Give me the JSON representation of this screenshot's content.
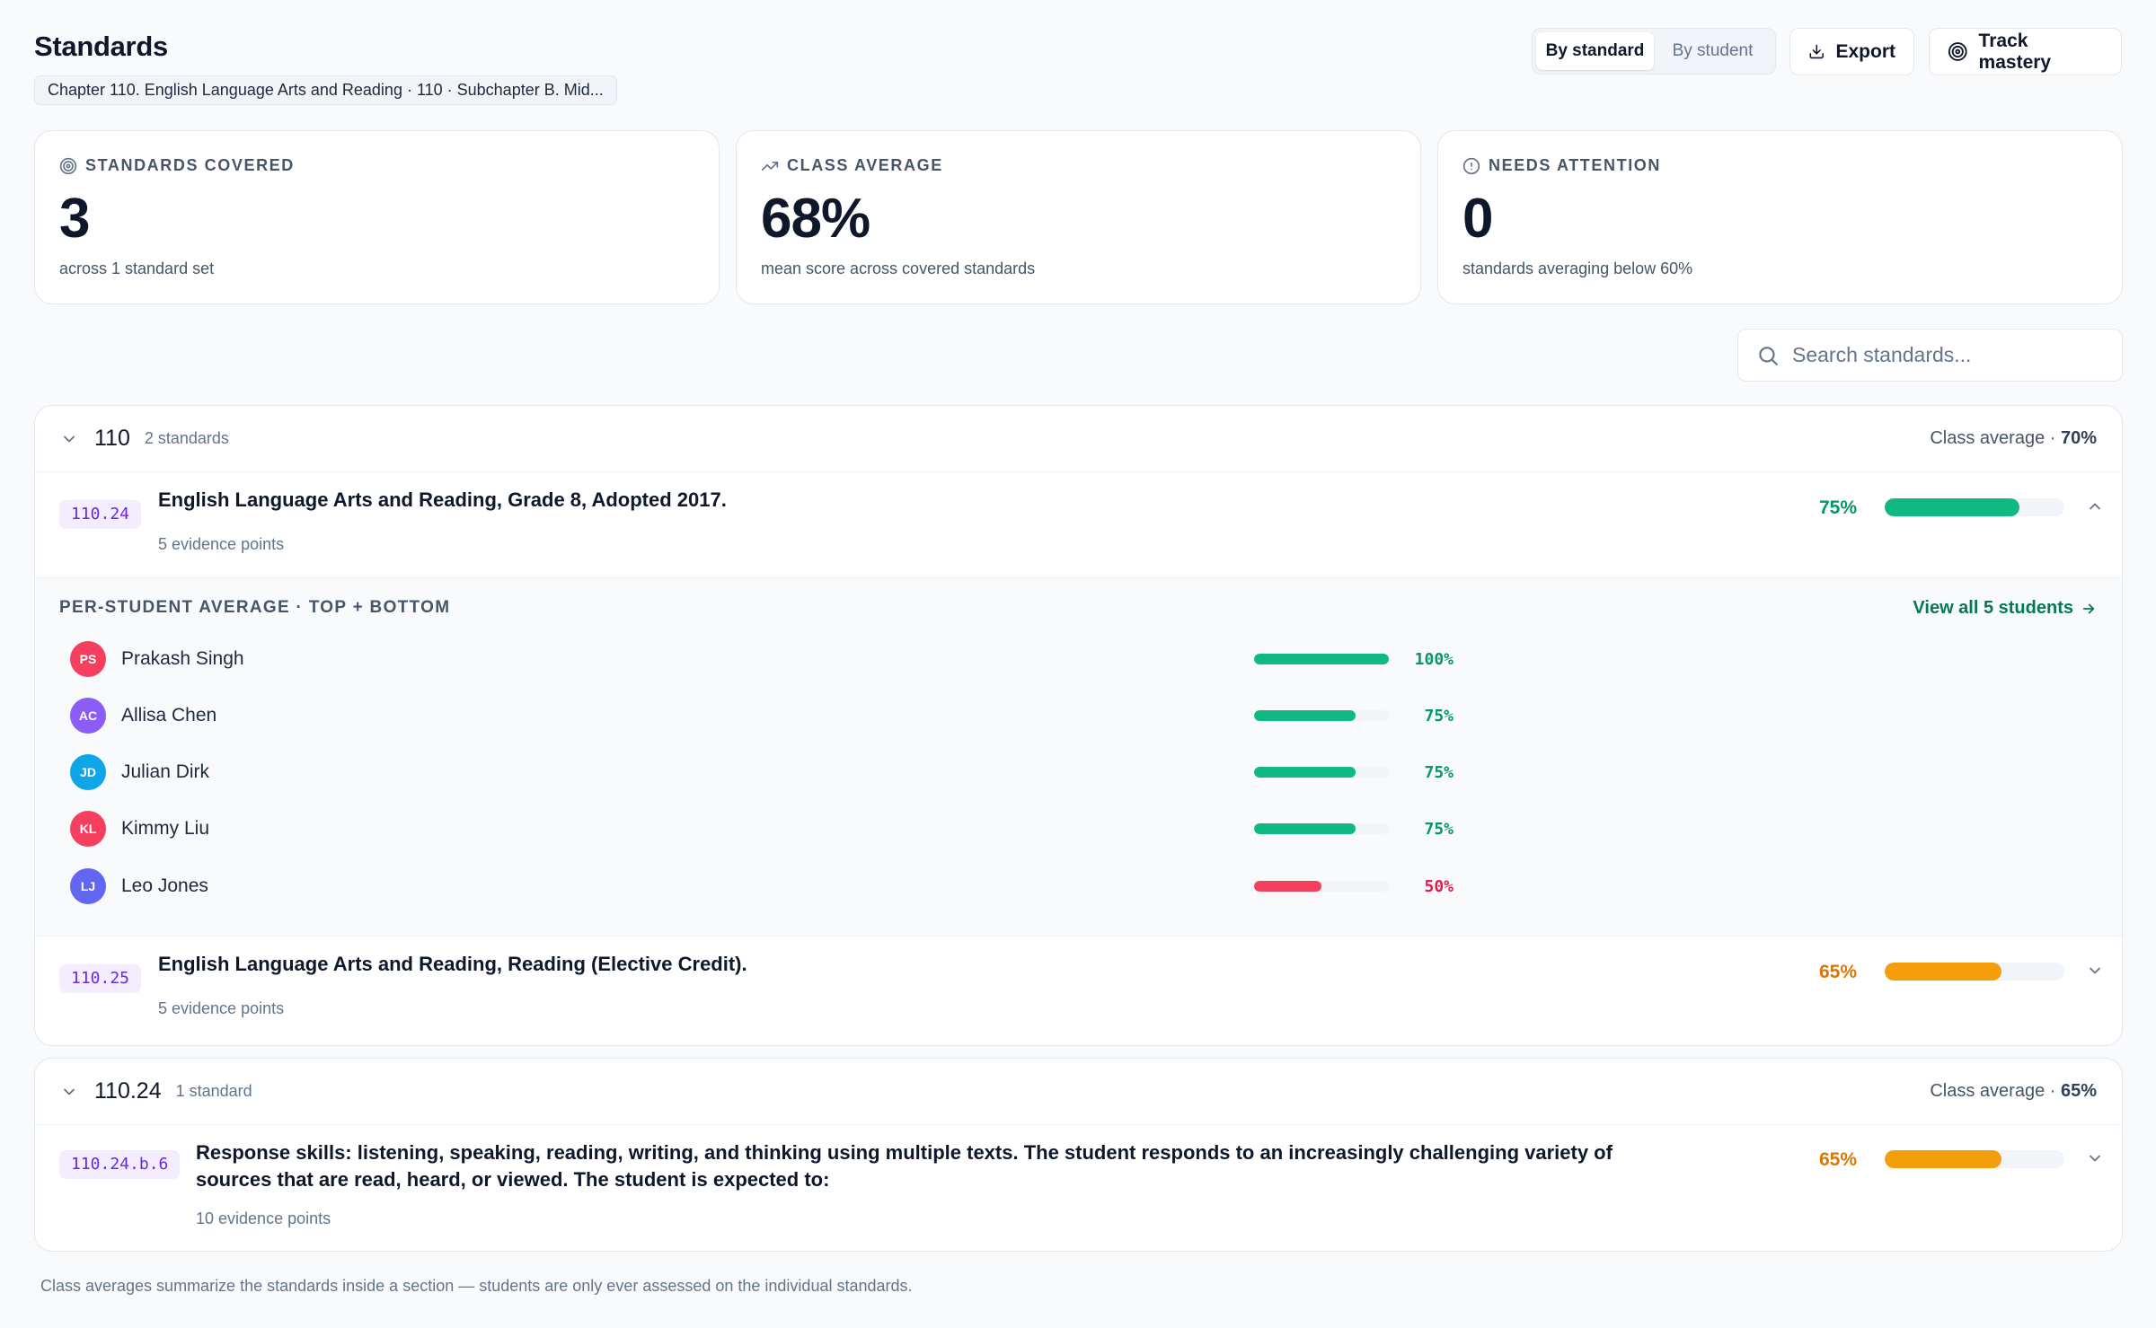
{
  "header": {
    "title": "Standards",
    "breadcrumb": "Chapter 110. English Language Arts and Reading · 110 · Subchapter B. Mid...",
    "view_toggle": {
      "by_standard": "By standard",
      "by_student": "By student",
      "active": "By standard"
    },
    "export_label": "Export",
    "track_mastery_label": "Track mastery"
  },
  "stats": [
    {
      "icon": "target-icon",
      "label": "STANDARDS COVERED",
      "value": "3",
      "sub": "across 1 standard set"
    },
    {
      "icon": "trending-up-icon",
      "label": "CLASS AVERAGE",
      "value": "68%",
      "sub": "mean score across covered standards"
    },
    {
      "icon": "alert-circle-icon",
      "label": "NEEDS ATTENTION",
      "value": "0",
      "sub": "standards averaging below 60%"
    }
  ],
  "search": {
    "placeholder": "Search standards..."
  },
  "colors": {
    "green": "#10b981",
    "amber": "#f59e0b",
    "red": "#f43f5e",
    "accent_green_text": "#059669",
    "amber_text": "#d97706",
    "red_text": "#e11d48"
  },
  "sections": [
    {
      "title": "110",
      "count": "2 standards",
      "avg_prefix": "Class average · ",
      "avg": "70%",
      "standards": [
        {
          "code": "110.24",
          "title": "English Language Arts and Reading, Grade 8, Adopted 2017.",
          "evidence": "5 evidence points",
          "pct_label": "75%",
          "value": 0.75,
          "color": "green",
          "expanded": true,
          "detail": {
            "heading": "PER-STUDENT AVERAGE · TOP + BOTTOM",
            "view_all": "View all 5 students",
            "students": [
              {
                "initials": "PS",
                "name": "Prakash Singh",
                "pct_label": "100%",
                "value": 1.0,
                "avatar_color": "#f43f5e",
                "color": "green"
              },
              {
                "initials": "AC",
                "name": "Allisa Chen",
                "pct_label": "75%",
                "value": 0.75,
                "avatar_color": "#8b5cf6",
                "color": "green"
              },
              {
                "initials": "JD",
                "name": "Julian Dirk",
                "pct_label": "75%",
                "value": 0.75,
                "avatar_color": "#0ea5e9",
                "color": "green"
              },
              {
                "initials": "KL",
                "name": "Kimmy Liu",
                "pct_label": "75%",
                "value": 0.75,
                "avatar_color": "#f43f5e",
                "color": "green"
              },
              {
                "initials": "LJ",
                "name": "Leo Jones",
                "pct_label": "50%",
                "value": 0.5,
                "avatar_color": "#6366f1",
                "color": "red"
              }
            ]
          }
        },
        {
          "code": "110.25",
          "title": "English Language Arts and Reading, Reading (Elective Credit).",
          "evidence": "5 evidence points",
          "pct_label": "65%",
          "value": 0.65,
          "color": "amber",
          "expanded": false
        }
      ]
    },
    {
      "title": "110.24",
      "count": "1 standard",
      "avg_prefix": "Class average · ",
      "avg": "65%",
      "standards": [
        {
          "code": "110.24.b.6",
          "title": "Response skills: listening, speaking, reading, writing, and thinking using multiple texts. The student responds to an increasingly challenging variety of sources that are read, heard, or viewed. The student is expected to:",
          "evidence": "10 evidence points",
          "pct_label": "65%",
          "value": 0.65,
          "color": "amber",
          "expanded": false
        }
      ]
    }
  ],
  "footnote": "Class averages summarize the standards inside a section — students are only ever assessed on the individual standards."
}
